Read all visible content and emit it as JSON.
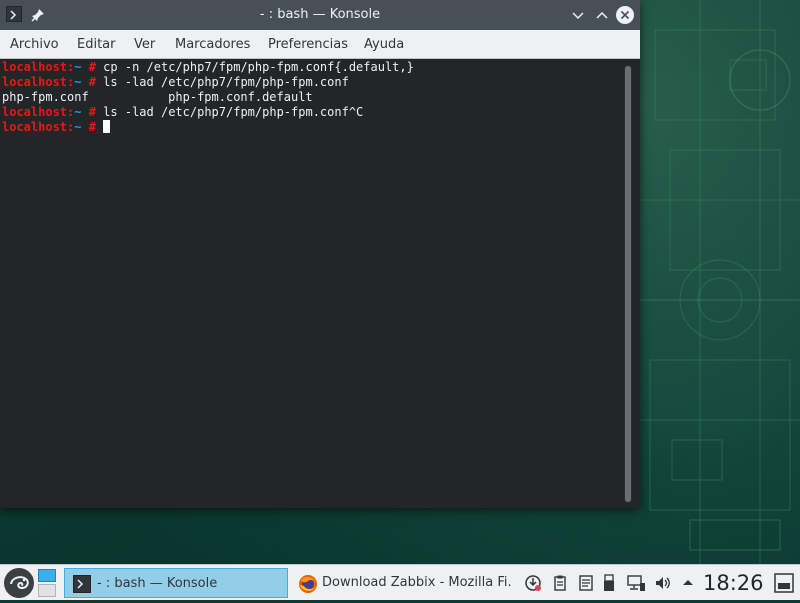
{
  "window": {
    "title": "- : bash — Konsole"
  },
  "menubar": {
    "items": [
      "Archivo",
      "Editar",
      "Ver",
      "Marcadores",
      "Preferencias",
      "Ayuda"
    ]
  },
  "terminal": {
    "prompt_host": "localhost",
    "prompt_sep": ":",
    "prompt_path": "~",
    "prompt_symbol": " #",
    "lines": [
      {
        "type": "command",
        "text": " cp -n /etc/php7/fpm/php-fpm.conf{.default,}"
      },
      {
        "type": "command",
        "text": " ls -lad /etc/php7/fpm/php-fpm.conf"
      },
      {
        "type": "output",
        "text": "php-fpm.conf           php-fpm.conf.default"
      },
      {
        "type": "command",
        "text": " ls -lad /etc/php7/fpm/php-fpm.conf^C"
      },
      {
        "type": "command",
        "text": " "
      }
    ]
  },
  "taskbar": {
    "tasks": [
      {
        "label": "- : bash — Konsole",
        "icon": "konsole-icon",
        "active": true
      },
      {
        "label": "Download Zabbix - Mozilla Fi...",
        "icon": "firefox-icon",
        "active": false
      }
    ],
    "tray_icons": [
      "updates-icon",
      "clipboard-icon",
      "notes-icon",
      "usb-icon",
      "printer-icon",
      "network-icon",
      "volume-icon",
      "tray-expand-icon"
    ],
    "clock": "18:26"
  },
  "colors": {
    "titlebar": "#475057",
    "terminal_bg": "#232627",
    "prompt_red": "#ed1515",
    "prompt_blue": "#1d99f3",
    "accent": "#3daee9"
  }
}
